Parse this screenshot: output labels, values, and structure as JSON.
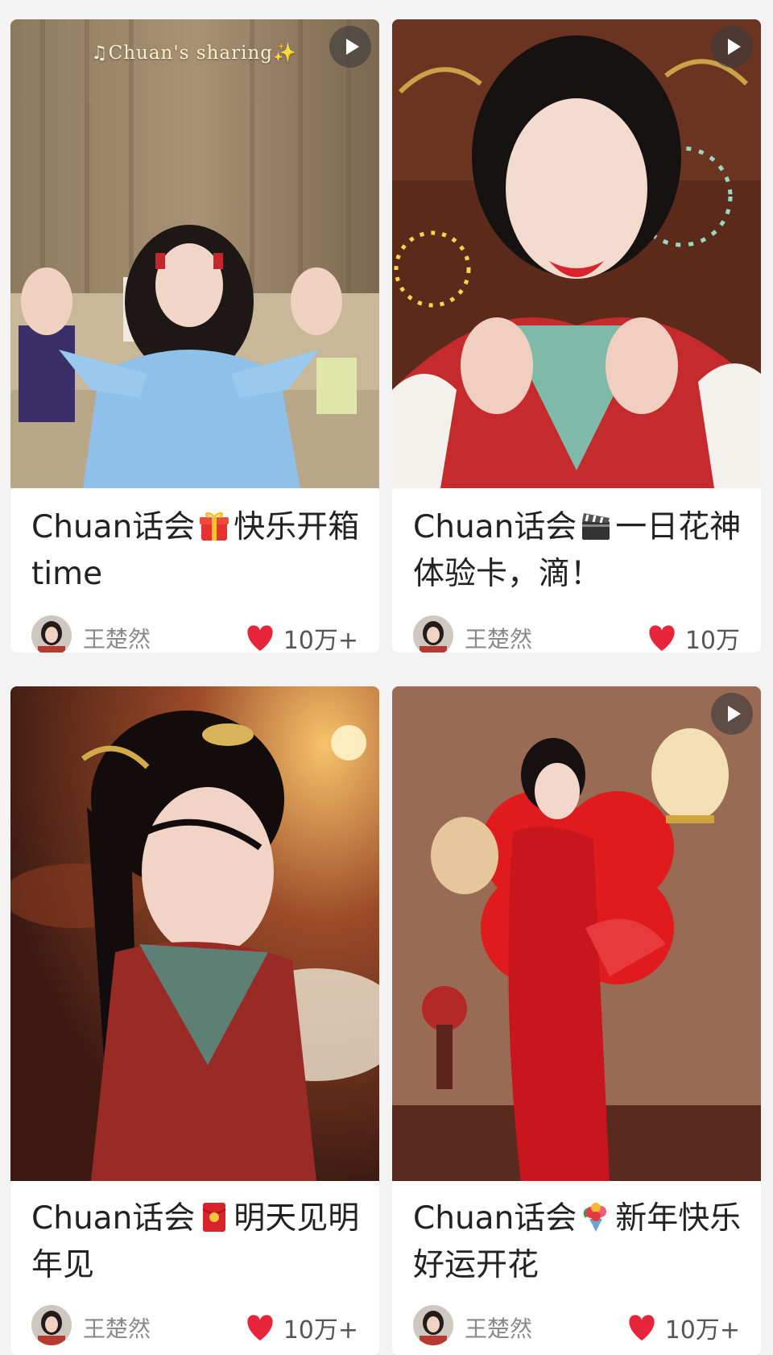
{
  "feed": {
    "cards": [
      {
        "title_prefix": "Chuan话会",
        "title_emoji": "gift-icon",
        "title_suffix": "快乐开箱time",
        "overlay_text": "♫Chuan's sharing✨",
        "has_play_button": true,
        "author": "王楚然",
        "likes": "10万+"
      },
      {
        "title_prefix": "Chuan话会",
        "title_emoji": "clapperboard-icon",
        "title_suffix": "一日花神体验卡，滴！",
        "has_play_button": true,
        "author": "王楚然",
        "likes": "10万"
      },
      {
        "title_prefix": "Chuan话会",
        "title_emoji": "red-envelope-icon",
        "title_suffix": "明天见明年见",
        "has_play_button": false,
        "author": "王楚然",
        "likes": "10万+"
      },
      {
        "title_prefix": "Chuan话会",
        "title_emoji": "bouquet-icon",
        "title_suffix": "新年快乐好运开花",
        "has_play_button": true,
        "author": "王楚然",
        "likes": "10万+"
      }
    ]
  },
  "colors": {
    "heart": "#e6243a",
    "card_bg": "#ffffff",
    "page_bg": "#f3f3f4",
    "author_text": "#8a8a8a"
  }
}
